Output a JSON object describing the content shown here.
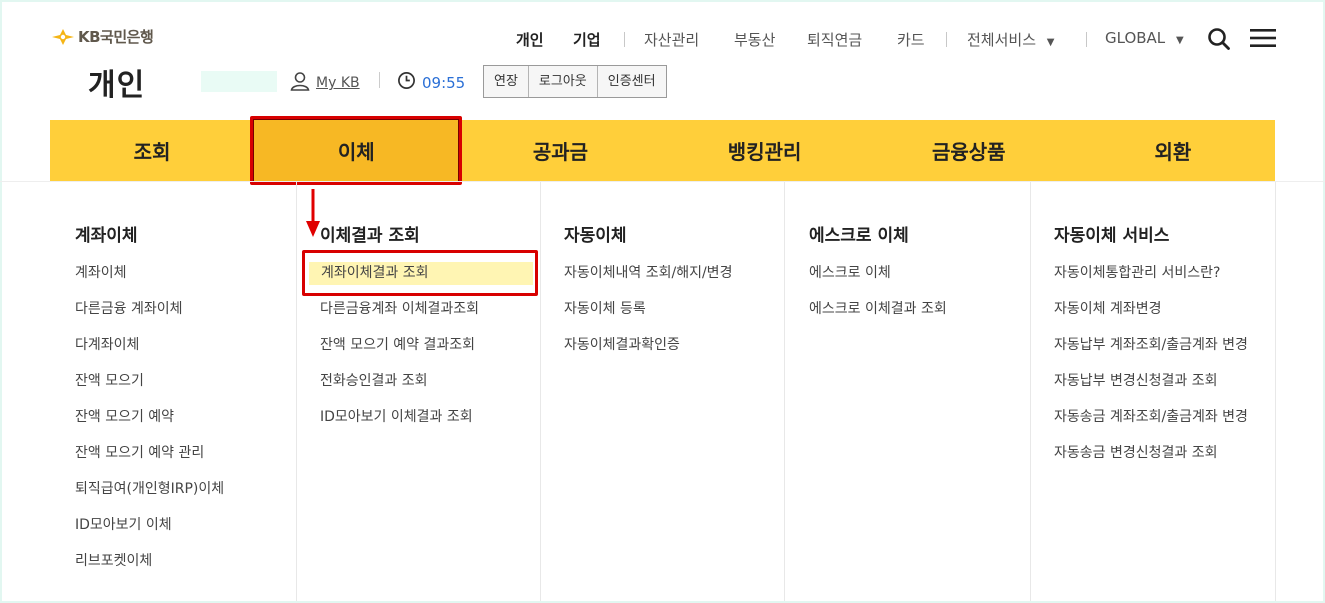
{
  "brand": {
    "text": "KB국민은행"
  },
  "header": {
    "page_title": "개인",
    "mykb": "My KB",
    "time": "09:55",
    "buttons": [
      "연장",
      "로그아웃",
      "인증센터"
    ]
  },
  "topnav": {
    "personal": "개인",
    "business": "기업",
    "asset": "자산관리",
    "realestate": "부동산",
    "pension": "퇴직연금",
    "card": "카드",
    "all_services": "전체서비스",
    "global": "GLOBAL"
  },
  "mainmenu": [
    {
      "label": "조회"
    },
    {
      "label": "이체",
      "active": true
    },
    {
      "label": "공과금"
    },
    {
      "label": "뱅킹관리"
    },
    {
      "label": "금융상품"
    },
    {
      "label": "외환"
    }
  ],
  "columns": [
    {
      "title": "계좌이체",
      "items": [
        "계좌이체",
        "다른금융 계좌이체",
        "다계좌이체",
        "잔액 모으기",
        "잔액 모으기 예약",
        "잔액 모으기 예약 관리",
        "퇴직급여(개인형IRP)이체",
        "ID모아보기 이체",
        "리브포켓이체"
      ]
    },
    {
      "title": "이체결과 조회",
      "items": [
        "계좌이체결과 조회",
        "다른금융계좌 이체결과조회",
        "잔액 모으기 예약 결과조회",
        "전화승인결과 조회",
        "ID모아보기 이체결과 조회"
      ]
    },
    {
      "title": "자동이체",
      "items": [
        "자동이체내역 조회/해지/변경",
        "자동이체 등록",
        "자동이체결과확인증"
      ]
    },
    {
      "title": "에스크로 이체",
      "items": [
        "에스크로 이체",
        "에스크로 이체결과 조회"
      ]
    },
    {
      "title": "자동이체 서비스",
      "items": [
        "자동이체통합관리 서비스란?",
        "자동이체 계좌변경",
        "자동납부 계좌조회/출금계좌 변경",
        "자동납부 변경신청결과 조회",
        "자동송금 계좌조회/출금계좌 변경",
        "자동송금 변경신청결과 조회"
      ]
    }
  ],
  "colors": {
    "menu_bar": "#ffcf3a",
    "menu_active": "#f7b824",
    "highlight_box": "#d80000",
    "highlight_fill": "#fff5b3",
    "brand_star": "#f5b516",
    "time": "#2a6fd6"
  }
}
